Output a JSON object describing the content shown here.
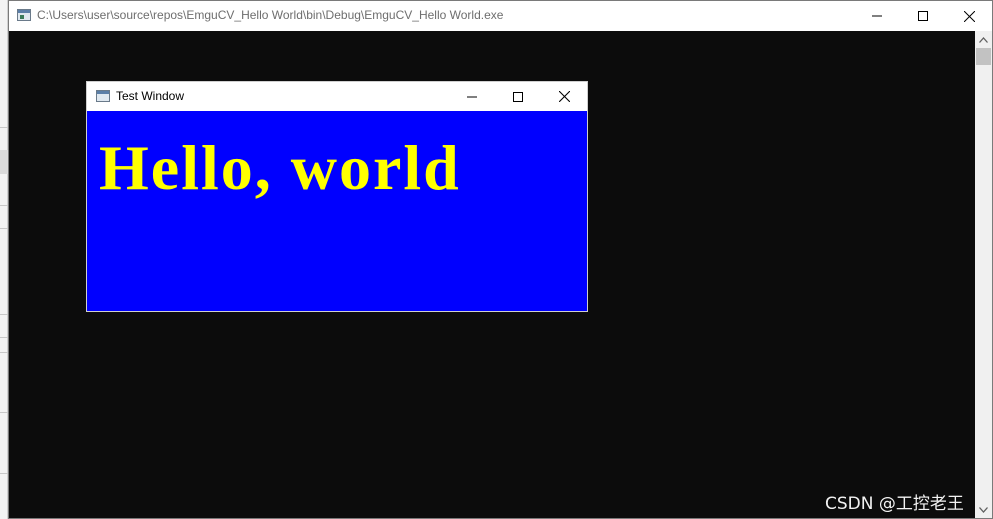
{
  "console_window": {
    "title": "C:\\Users\\user\\source\\repos\\EmguCV_Hello World\\bin\\Debug\\EmguCV_Hello World.exe",
    "background_color": "#0c0c0c",
    "icons": {
      "app": "console-app-icon",
      "minimize": "minimize-icon",
      "maximize": "maximize-icon",
      "close": "close-icon"
    }
  },
  "test_window": {
    "title": "Test Window",
    "image": {
      "text": "Hello, world",
      "background_color": "#0000ff",
      "text_color": "#ffff00"
    },
    "icons": {
      "app": "window-app-icon",
      "minimize": "minimize-icon",
      "maximize": "maximize-icon",
      "close": "close-icon"
    }
  },
  "watermark": "CSDN @工控老王"
}
